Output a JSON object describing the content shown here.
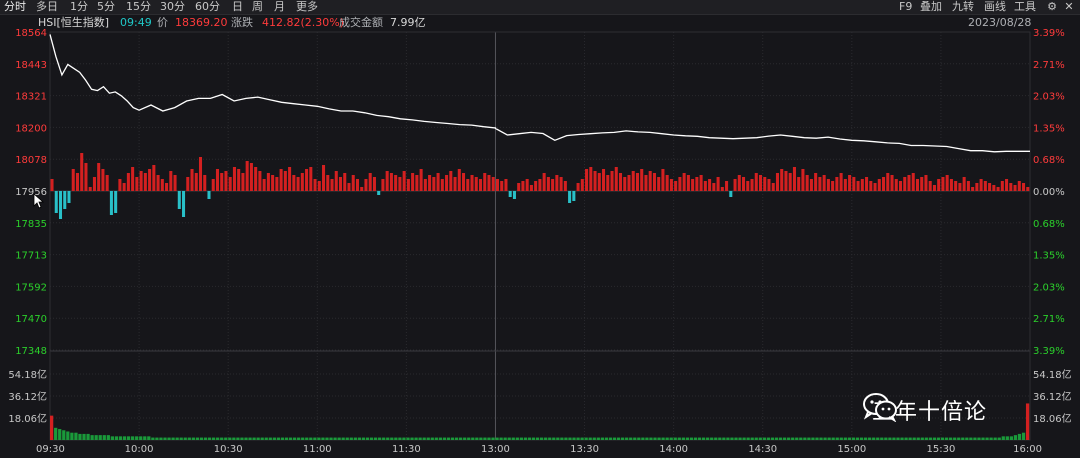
{
  "toolbar": {
    "periods": [
      "分时",
      "多日",
      "1分",
      "5分",
      "15分",
      "30分",
      "60分",
      "日",
      "周",
      "月",
      "更多"
    ],
    "active_period": "分时",
    "right_items": [
      "F9",
      "叠加",
      "九转",
      "画线",
      "工具"
    ],
    "settings_icon": "gear-icon",
    "close_icon": "close-icon"
  },
  "info": {
    "symbol": "HSI[恒生指数]",
    "time": "09:49",
    "price_label": "价",
    "price": "18369.20",
    "change_label": "涨跌",
    "change": "412.82(2.30%)",
    "volume_label": "成交金额",
    "volume": "7.99亿",
    "date": "2023/08/28"
  },
  "chart_data": {
    "type": "line",
    "title": "",
    "previous_close": 17956,
    "price_axis": {
      "ticks": [
        "18564",
        "18443",
        "18321",
        "18200",
        "18078",
        "17956",
        "17835",
        "17713",
        "17592",
        "17470",
        "17348"
      ],
      "range": [
        17348,
        18564
      ]
    },
    "percent_axis": {
      "ticks": [
        "3.39%",
        "2.71%",
        "2.03%",
        "1.35%",
        "0.68%",
        "0.00%",
        "0.68%",
        "1.35%",
        "2.03%",
        "2.71%",
        "3.39%"
      ]
    },
    "volume_axis": {
      "ticks": [
        "54.18亿",
        "36.12亿",
        "18.06亿"
      ],
      "range": [
        0,
        72.24
      ],
      "unit": "亿"
    },
    "time_axis": {
      "ticks": [
        "09:30",
        "10:00",
        "10:30",
        "11:00",
        "11:30",
        "13:00",
        "13:30",
        "14:00",
        "14:30",
        "15:00",
        "15:30",
        "16:00"
      ]
    },
    "grid": true,
    "series": [
      {
        "x": [
          "09:30",
          "09:32",
          "09:34",
          "09:36",
          "09:38",
          "09:40",
          "09:42",
          "09:44",
          "09:46",
          "09:48",
          "09:50",
          "09:52",
          "09:54",
          "09:56",
          "09:58",
          "10:00",
          "10:04",
          "10:08",
          "10:12",
          "10:16",
          "10:20",
          "10:24",
          "10:28",
          "10:32",
          "10:36",
          "10:40",
          "10:44",
          "10:48",
          "10:52",
          "10:56",
          "11:00",
          "11:04",
          "11:08",
          "11:12",
          "11:16",
          "11:20",
          "11:24",
          "11:28",
          "11:32",
          "11:36",
          "11:40",
          "11:44",
          "11:48",
          "11:52",
          "11:56",
          "12:00",
          "13:00",
          "13:04",
          "13:08",
          "13:12",
          "13:16",
          "13:20",
          "13:24",
          "13:28",
          "13:32",
          "13:36",
          "13:40",
          "13:44",
          "13:48",
          "13:52",
          "13:56",
          "14:00",
          "14:04",
          "14:08",
          "14:12",
          "14:16",
          "14:20",
          "14:24",
          "14:28",
          "14:32",
          "14:36",
          "14:40",
          "14:44",
          "14:48",
          "14:52",
          "14:56",
          "15:00",
          "15:04",
          "15:08",
          "15:12",
          "15:16",
          "15:20",
          "15:24",
          "15:28",
          "15:32",
          "15:36",
          "15:40",
          "15:44",
          "15:48",
          "15:52",
          "15:56",
          "16:00"
        ],
        "values": [
          18555,
          18470,
          18400,
          18440,
          18425,
          18410,
          18380,
          18345,
          18340,
          18355,
          18330,
          18335,
          18320,
          18300,
          18275,
          18265,
          18285,
          18262,
          18275,
          18300,
          18310,
          18310,
          18325,
          18300,
          18310,
          18315,
          18305,
          18295,
          18290,
          18285,
          18280,
          18270,
          18262,
          18262,
          18255,
          18245,
          18240,
          18232,
          18228,
          18222,
          18218,
          18214,
          18210,
          18208,
          18202,
          18197,
          18195,
          18170,
          18175,
          18180,
          18176,
          18150,
          18168,
          18172,
          18175,
          18178,
          18180,
          18186,
          18182,
          18180,
          18175,
          18170,
          18167,
          18165,
          18160,
          18158,
          18156,
          18158,
          18160,
          18166,
          18170,
          18165,
          18160,
          18158,
          18162,
          18155,
          18150,
          18148,
          18144,
          18140,
          18138,
          18130,
          18130,
          18128,
          18126,
          18118,
          18110,
          18110,
          18106,
          18108,
          18108,
          18108
        ]
      }
    ],
    "momentum_bars": {
      "values": [
        0.3,
        -0.55,
        -0.7,
        -0.45,
        -0.3,
        0.55,
        0.45,
        0.95,
        0.7,
        0.1,
        0.35,
        0.7,
        0.55,
        0.4,
        -0.6,
        -0.55,
        0.3,
        0.2,
        0.45,
        0.6,
        0.35,
        0.5,
        0.45,
        0.55,
        0.65,
        0.4,
        0.3,
        0.2,
        0.5,
        0.4,
        -0.45,
        -0.65,
        0.35,
        0.55,
        0.45,
        0.85,
        0.4,
        -0.2,
        0.3,
        0.55,
        0.45,
        0.5,
        0.35,
        0.6,
        0.55,
        0.45,
        0.75,
        0.7,
        0.6,
        0.5,
        0.3,
        0.45,
        0.4,
        0.35,
        0.55,
        0.5,
        0.6,
        0.4,
        0.35,
        0.45,
        0.55,
        0.6,
        0.3,
        0.25,
        0.65,
        0.4,
        0.3,
        0.5,
        0.35,
        0.45,
        0.2,
        0.4,
        0.3,
        0.1,
        0.3,
        0.45,
        0.35,
        -0.1,
        0.3,
        0.5,
        0.45,
        0.4,
        0.35,
        0.5,
        0.3,
        0.45,
        0.4,
        0.55,
        0.3,
        0.4,
        0.35,
        0.45,
        0.3,
        0.4,
        0.5,
        0.35,
        0.55,
        0.45,
        0.3,
        0.4,
        0.35,
        0.3,
        0.45,
        0.4,
        0.35,
        0.3,
        0.25,
        0.3,
        -0.15,
        -0.2,
        0.2,
        0.25,
        0.3,
        0.15,
        0.25,
        0.3,
        0.45,
        0.35,
        0.3,
        0.4,
        0.35,
        0.25,
        -0.3,
        -0.25,
        0.2,
        0.3,
        0.55,
        0.6,
        0.5,
        0.45,
        0.55,
        0.4,
        0.5,
        0.6,
        0.45,
        0.35,
        0.4,
        0.5,
        0.45,
        0.55,
        0.4,
        0.5,
        0.45,
        0.35,
        0.55,
        0.4,
        0.3,
        0.25,
        0.35,
        0.45,
        0.4,
        0.3,
        0.35,
        0.4,
        0.25,
        0.3,
        0.2,
        0.35,
        0.1,
        0.25,
        -0.15,
        0.3,
        0.4,
        0.35,
        0.25,
        0.3,
        0.45,
        0.4,
        0.35,
        0.3,
        0.2,
        0.45,
        0.55,
        0.5,
        0.45,
        0.6,
        0.35,
        0.55,
        0.4,
        0.3,
        0.45,
        0.35,
        0.4,
        0.3,
        0.25,
        0.35,
        0.45,
        0.3,
        0.4,
        0.35,
        0.25,
        0.3,
        0.35,
        0.25,
        0.2,
        0.3,
        0.35,
        0.45,
        0.4,
        0.3,
        0.25,
        0.35,
        0.4,
        0.45,
        0.3,
        0.35,
        0.4,
        0.25,
        0.15,
        0.3,
        0.35,
        0.4,
        0.3,
        0.25,
        0.2,
        0.35,
        0.25,
        0.1,
        0.2,
        0.3,
        0.25,
        0.2,
        0.15,
        0.1,
        0.25,
        0.3,
        0.2,
        0.15,
        0.25,
        0.2,
        0.1
      ]
    },
    "volume_bars": {
      "values": [
        20,
        10,
        9,
        8,
        7,
        6,
        6,
        5,
        5,
        5,
        4,
        4,
        4,
        4,
        4,
        3,
        3,
        3,
        3,
        3,
        3,
        3,
        3,
        3,
        3,
        2,
        2,
        2,
        2,
        2,
        2,
        2,
        2,
        2,
        2,
        2,
        2,
        2,
        2,
        2,
        2,
        2,
        2,
        2,
        2,
        2,
        2,
        2,
        2,
        2,
        2,
        2,
        2,
        2,
        2,
        2,
        2,
        2,
        2,
        2,
        2,
        2,
        2,
        2,
        2,
        2,
        2,
        2,
        2,
        2,
        2,
        2,
        2,
        2,
        2,
        2,
        2,
        2,
        2,
        2,
        2,
        2,
        2,
        2,
        2,
        2,
        2,
        2,
        2,
        2,
        2,
        2,
        2,
        2,
        2,
        2,
        2,
        2,
        2,
        2,
        2,
        2,
        2,
        2,
        2,
        2,
        2,
        2,
        2,
        2,
        2,
        2,
        2,
        2,
        2,
        2,
        2,
        2,
        2,
        2,
        2,
        2,
        2,
        2,
        2,
        2,
        2,
        2,
        2,
        2,
        2,
        2,
        2,
        2,
        2,
        2,
        2,
        2,
        2,
        2,
        2,
        2,
        2,
        2,
        2,
        2,
        2,
        2,
        2,
        2,
        2,
        2,
        2,
        2,
        2,
        2,
        2,
        2,
        2,
        2,
        2,
        2,
        2,
        2,
        2,
        2,
        2,
        2,
        2,
        2,
        2,
        2,
        2,
        2,
        2,
        2,
        2,
        2,
        2,
        2,
        2,
        2,
        2,
        2,
        2,
        2,
        2,
        2,
        2,
        2,
        2,
        2,
        2,
        2,
        2,
        2,
        2,
        2,
        2,
        2,
        2,
        2,
        2,
        2,
        2,
        2,
        2,
        2,
        2,
        2,
        2,
        2,
        2,
        2,
        2,
        2,
        2,
        2,
        2,
        2,
        2,
        2,
        2,
        2,
        2,
        2,
        2,
        2,
        2,
        2,
        2,
        2,
        2,
        2,
        2,
        3,
        3,
        3,
        4,
        5,
        6,
        30
      ]
    }
  },
  "colors": {
    "background": "#16161a",
    "price_line": "#ffffff",
    "up": "#d42020",
    "down": "#29c0c8",
    "axis_up_text": "#ff3b3b",
    "axis_down_text": "#2bd02b",
    "grid": "#2a2a2e",
    "volume": "#1a9a3a"
  },
  "watermark": {
    "text": "五年十倍论",
    "icon": "wechat-icon"
  }
}
